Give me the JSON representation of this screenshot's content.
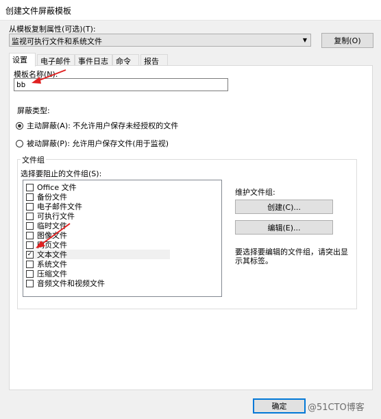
{
  "window": {
    "title": "创建文件屏蔽模板"
  },
  "copy_from": {
    "label": "从模板复制属性(可选)(T):",
    "selected": "监视可执行文件和系统文件",
    "copy_button": "复制(O)"
  },
  "tabs": [
    {
      "label": "设置",
      "active": true
    },
    {
      "label": "电子邮件"
    },
    {
      "label": "事件日志"
    },
    {
      "label": "命令"
    },
    {
      "label": "报告"
    }
  ],
  "settings": {
    "template_name_label": "模板名称(N):",
    "template_name_value": "bb",
    "screen_type_label": "屏蔽类型:",
    "active_option": "主动屏蔽(A): 不允许用户保存未经授权的文件",
    "passive_option": "被动屏蔽(P): 允许用户保存文件(用于监视)",
    "selected_screen_type": "active"
  },
  "file_groups": {
    "group_title": "文件组",
    "list_label": "选择要阻止的文件组(S):",
    "items": [
      {
        "label": "Office 文件",
        "checked": false
      },
      {
        "label": "备份文件",
        "checked": false
      },
      {
        "label": "电子邮件文件",
        "checked": false
      },
      {
        "label": "可执行文件",
        "checked": false
      },
      {
        "label": "临时文件",
        "checked": false
      },
      {
        "label": "图像文件",
        "checked": false
      },
      {
        "label": "网页文件",
        "checked": false
      },
      {
        "label": "文本文件",
        "checked": true
      },
      {
        "label": "系统文件",
        "checked": false
      },
      {
        "label": "压缩文件",
        "checked": false
      },
      {
        "label": "音频文件和视频文件",
        "checked": false
      }
    ],
    "maintain_label": "维护文件组:",
    "create_button": "创建(C)...",
    "edit_button": "编辑(E)...",
    "hint": "要选择要编辑的文件组，请突出显示其标签。"
  },
  "footer": {
    "ok_button": "确定"
  },
  "watermark": "@51CTO博客",
  "colors": {
    "accent": "#0078d7",
    "arrow": "#e02020"
  }
}
